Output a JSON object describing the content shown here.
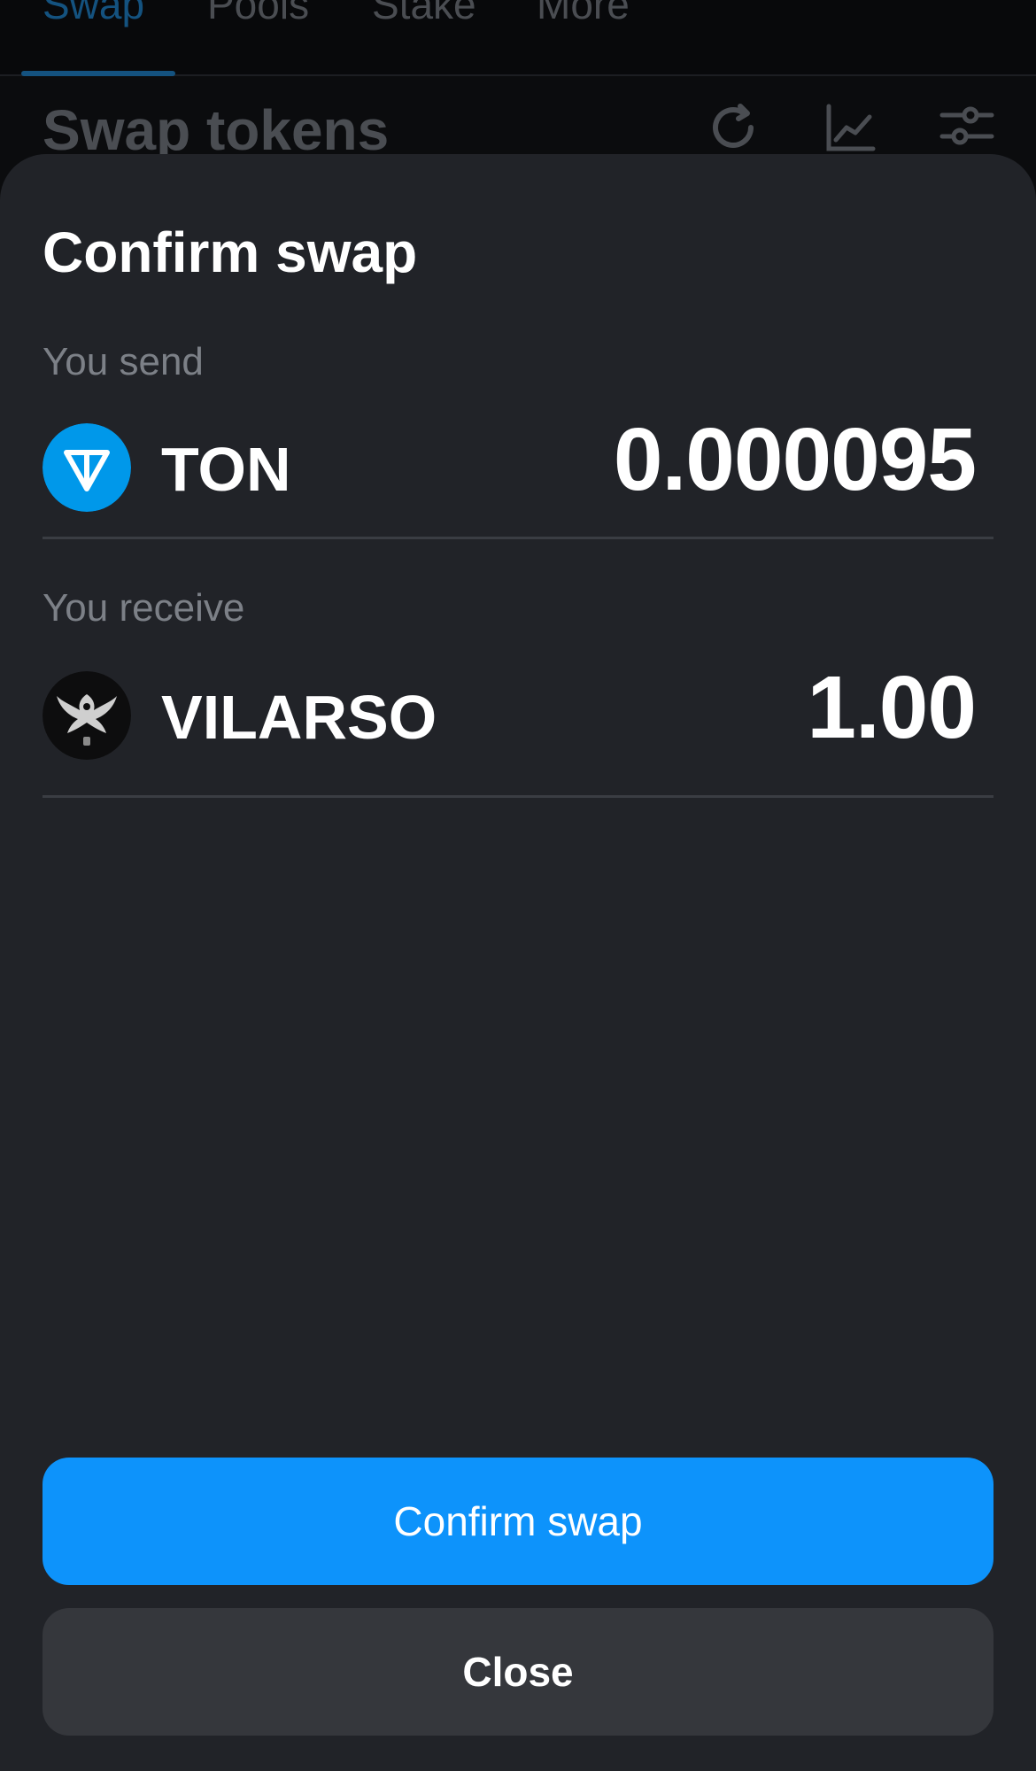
{
  "background": {
    "tabs": [
      {
        "label": "Swap",
        "active": true
      },
      {
        "label": "Pools",
        "active": false
      },
      {
        "label": "Stake",
        "active": false
      },
      {
        "label": "More",
        "active": false
      }
    ],
    "title": "Swap tokens",
    "icons": [
      "refresh-icon",
      "chart-icon",
      "settings-sliders-icon"
    ]
  },
  "sheet": {
    "title": "Confirm swap",
    "send": {
      "label": "You send",
      "token": "TON",
      "amount": "0.000095",
      "icon": "ton-token-icon"
    },
    "receive": {
      "label": "You receive",
      "token": "VILARSO",
      "amount": "1.00",
      "icon": "vilarso-token-icon"
    },
    "confirm_label": "Confirm swap",
    "close_label": "Close"
  },
  "colors": {
    "accent": "#0d93fb",
    "sheet_bg": "#212328",
    "secondary_button": "#35373c"
  }
}
